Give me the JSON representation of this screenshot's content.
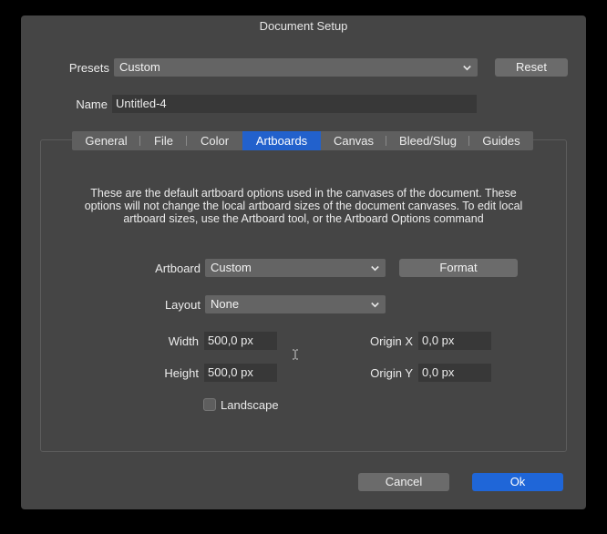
{
  "window": {
    "title": "Document Setup"
  },
  "presets": {
    "label": "Presets",
    "value": "Custom",
    "reset_label": "Reset"
  },
  "name": {
    "label": "Name",
    "value": "Untitled-4"
  },
  "tabs": [
    {
      "label": "General"
    },
    {
      "label": "File"
    },
    {
      "label": "Color"
    },
    {
      "label": "Artboards"
    },
    {
      "label": "Canvas"
    },
    {
      "label": "Bleed/Slug"
    },
    {
      "label": "Guides"
    }
  ],
  "active_tab": "Artboards",
  "artboards": {
    "info_text": "These are the default artboard options used in the canvases of the document. These options will not change the local artboard sizes of the document canvases. To edit local artboard sizes, use the Artboard tool, or the Artboard Options command",
    "artboard_label": "Artboard",
    "artboard_value": "Custom",
    "format_label": "Format",
    "layout_label": "Layout",
    "layout_value": "None",
    "width_label": "Width",
    "width_value": "500,0 px",
    "height_label": "Height",
    "height_value": "500,0 px",
    "origin_x_label": "Origin X",
    "origin_x_value": "0,0 px",
    "origin_y_label": "Origin Y",
    "origin_y_value": "0,0 px",
    "landscape_label": "Landscape",
    "landscape_checked": false
  },
  "footer": {
    "cancel_label": "Cancel",
    "ok_label": "Ok"
  },
  "colors": {
    "accent": "#1f66d8",
    "background": "#454545"
  }
}
